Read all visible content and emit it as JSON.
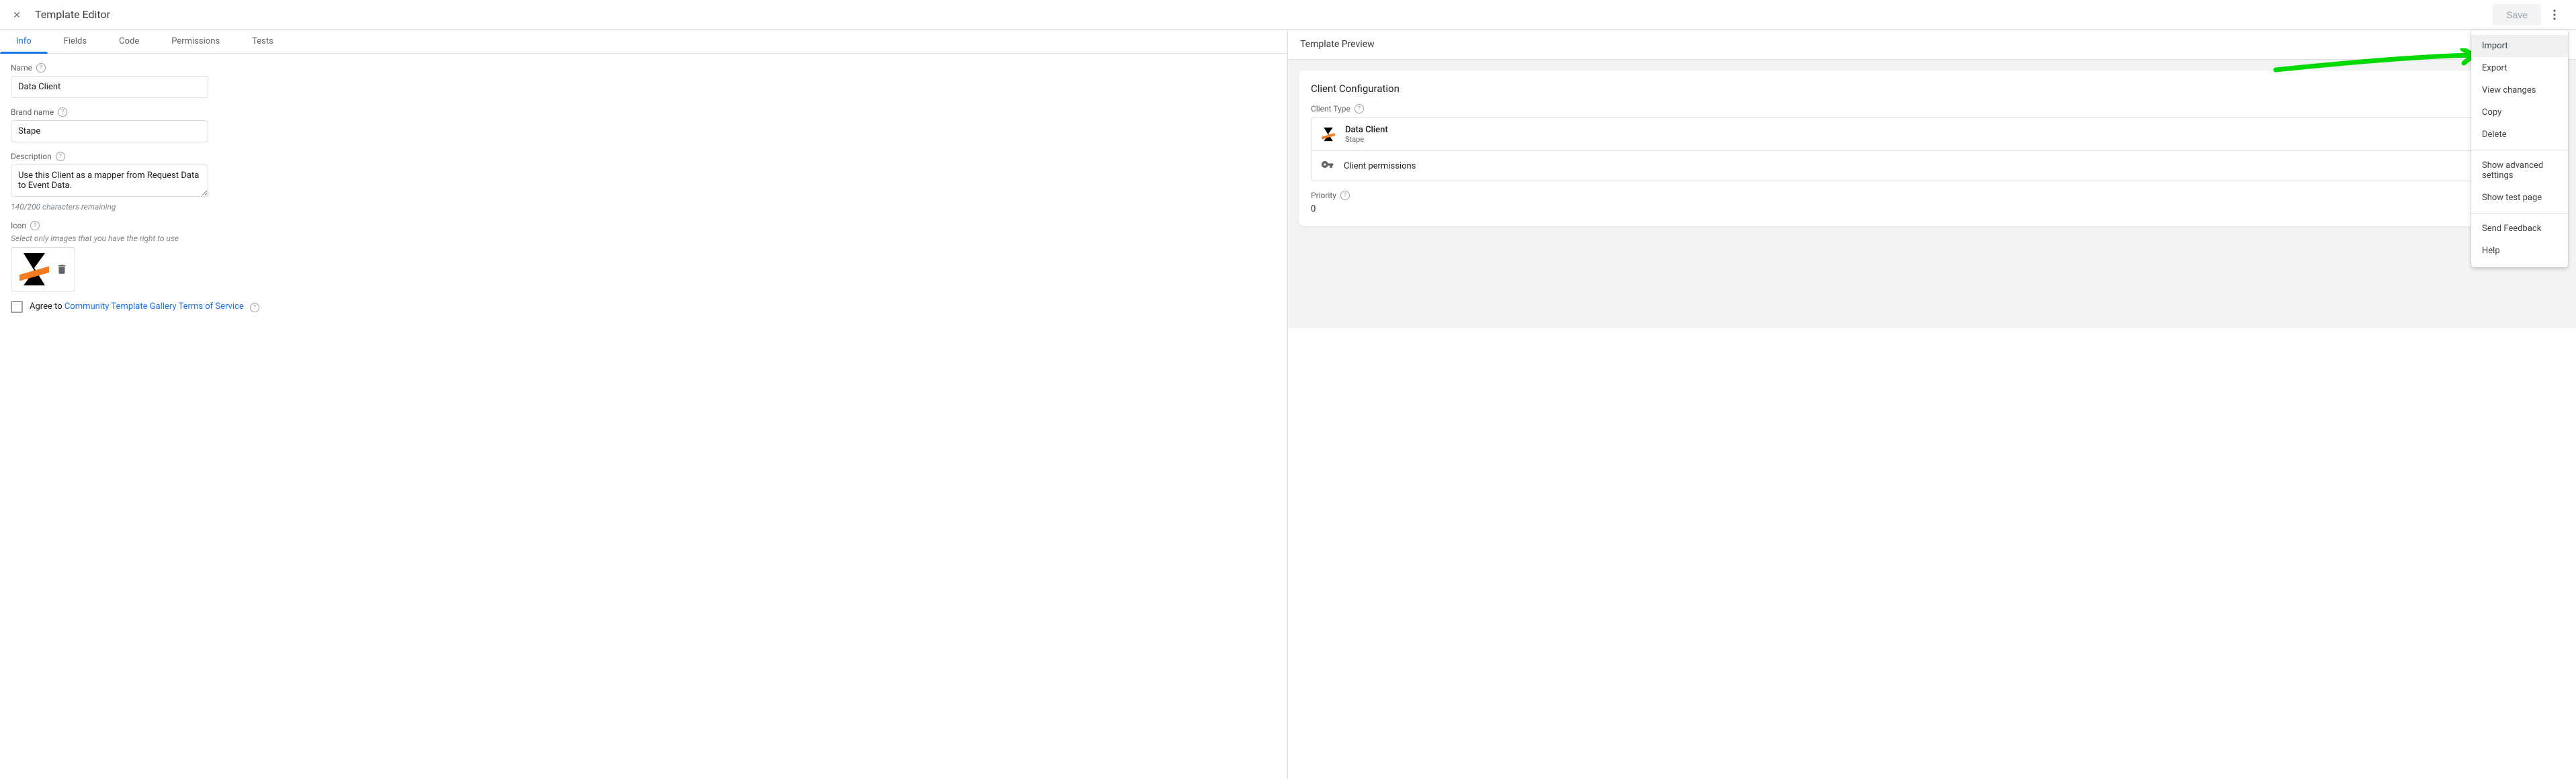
{
  "header": {
    "title": "Template Editor",
    "save_label": "Save"
  },
  "tabs": [
    "Info",
    "Fields",
    "Code",
    "Permissions",
    "Tests"
  ],
  "active_tab": 0,
  "form": {
    "name_label": "Name",
    "name_value": "Data Client",
    "brand_label": "Brand name",
    "brand_value": "Stape",
    "desc_label": "Description",
    "desc_value": "Use this Client as a mapper from Request Data to Event Data.",
    "chars_remaining": "140/200 characters remaining",
    "icon_label": "Icon",
    "icon_helper": "Select only images that you have the right to use",
    "agree_prefix": "Agree to ",
    "agree_link": "Community Template Gallery Terms of Service"
  },
  "preview": {
    "header": "Template Preview",
    "card_title": "Client Configuration",
    "client_type_label": "Client Type",
    "client_name": "Data Client",
    "client_brand": "Stape",
    "client_permissions": "Client permissions",
    "priority_label": "Priority",
    "priority_value": "0"
  },
  "menu": {
    "items_group1": [
      "Import",
      "Export",
      "View changes",
      "Copy",
      "Delete"
    ],
    "items_group2": [
      "Show advanced settings",
      "Show test page"
    ],
    "items_group3": [
      "Send Feedback",
      "Help"
    ]
  }
}
